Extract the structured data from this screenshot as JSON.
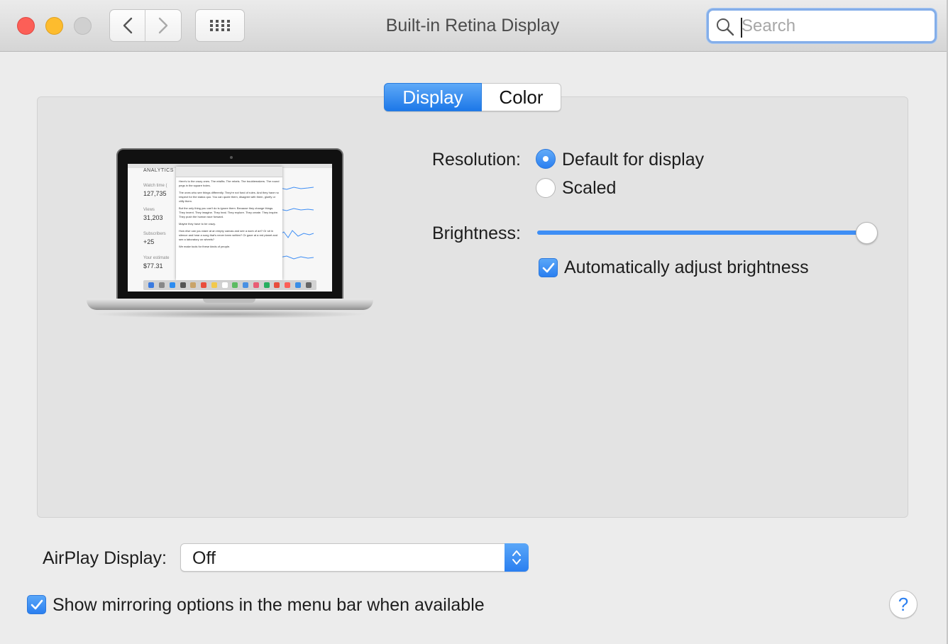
{
  "window": {
    "title": "Built-in Retina Display",
    "search_placeholder": "Search"
  },
  "icons": {
    "back": "chevron-left-icon",
    "forward": "chevron-right-icon",
    "grid": "show-all-grid-icon",
    "search": "magnifier-icon",
    "help": "question-mark-icon"
  },
  "tabs": [
    {
      "label": "Display",
      "selected": true
    },
    {
      "label": "Color",
      "selected": false
    }
  ],
  "display": {
    "resolution_label": "Resolution:",
    "resolution_options": [
      {
        "label": "Default for display",
        "selected": true
      },
      {
        "label": "Scaled",
        "selected": false
      }
    ],
    "brightness_label": "Brightness:",
    "brightness_value": 1.0,
    "auto_brightness_label": "Automatically adjust brightness",
    "auto_brightness_checked": true
  },
  "preview": {
    "heading": "ANALYTICS",
    "stats": [
      {
        "label": "Watch time (",
        "value": "127,735"
      },
      {
        "label": "Views",
        "value": "31,203"
      },
      {
        "label": "Subscribers",
        "value": "+25"
      },
      {
        "label": "Your estimate",
        "value": "$77.31"
      }
    ],
    "doc_paragraphs": [
      "Here's to the crazy ones. The misfits. The rebels. The troublemakers. The round pegs in the square holes.",
      "The ones who see things differently. They're not fond of rules. And they have no respect for the status quo. You can quote them, disagree with them, glorify or vilify them.",
      "But the only thing you can't do is ignore them. Because they change things. They invent. They imagine. They heal. They explore. They create. They inspire. They push the human race forward.",
      "Maybe they have to be crazy.",
      "How else can you stare at an empty canvas and see a work of art? Or sit in silence and hear a song that's never been written? Or gaze at a red planet and see a laboratory on wheels?",
      "We make tools for these kinds of people."
    ]
  },
  "airplay": {
    "label": "AirPlay Display:",
    "value": "Off"
  },
  "mirroring": {
    "label": "Show mirroring options in the menu bar when available",
    "checked": true
  },
  "help": {
    "label": "?"
  },
  "colors": {
    "accent": "#2a7ff0",
    "close": "#fc5f57",
    "minimize": "#fdbc2e",
    "zoom": "#d0d0d0"
  }
}
